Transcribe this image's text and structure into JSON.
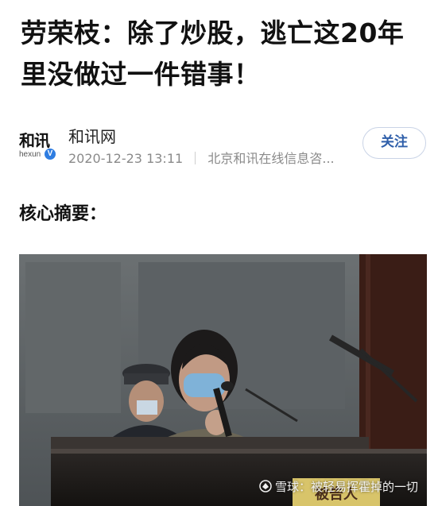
{
  "article": {
    "title": "劳荣枝：除了炒股，逃亡这20年里没做过一件错事！",
    "source": {
      "logo_text": "和讯",
      "logo_sub": "hexun",
      "verified_mark": "V",
      "name": "和讯网",
      "datetime": "2020-12-23 13:11",
      "publisher": "北京和讯在线信息咨..."
    },
    "follow_label": "关注",
    "section_heading": "核心摘要："
  },
  "photo": {
    "watermark": "雪球：被轻易挥霍掉的一切",
    "sign_text": "被告人"
  },
  "colors": {
    "follow_text": "#2f5faa",
    "verified_badge": "#2f7de1"
  }
}
